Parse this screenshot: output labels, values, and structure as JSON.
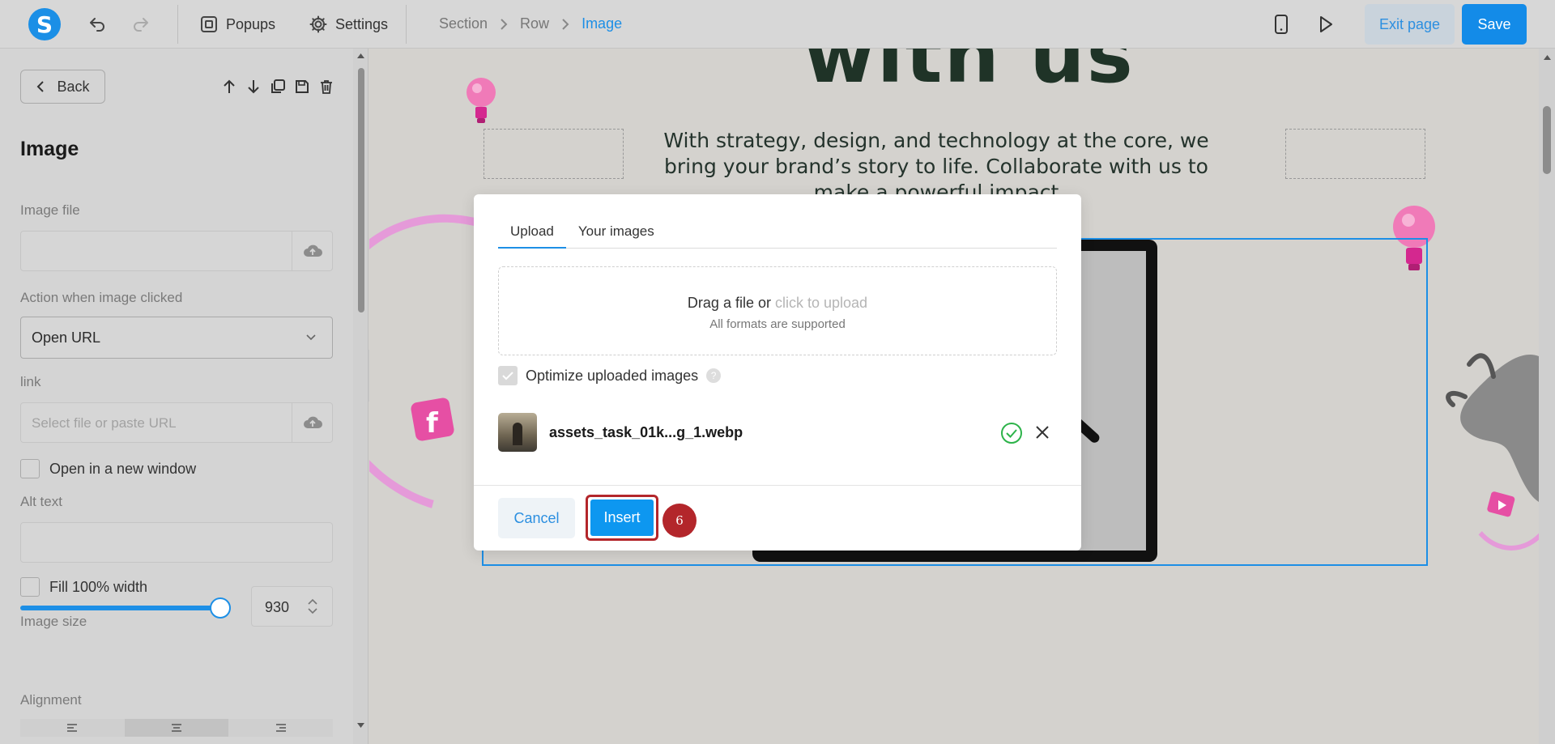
{
  "toolbar": {
    "logo_letter": "S",
    "popups_label": "Popups",
    "settings_label": "Settings",
    "breadcrumb": [
      "Section",
      "Row",
      "Image"
    ],
    "exit_label": "Exit page",
    "save_label": "Save"
  },
  "sidebar": {
    "back_label": "Back",
    "title": "Image",
    "image_file_label": "Image file",
    "action_label": "Action when image clicked",
    "action_value": "Open URL",
    "link_label": "link",
    "link_placeholder": "Select file or paste URL",
    "new_window_label": "Open in a new window",
    "alt_text_label": "Alt text",
    "fill_width_label": "Fill 100% width",
    "image_size_label": "Image size",
    "image_size_value": "930",
    "image_size_fraction": 0.95,
    "alignment_label": "Alignment"
  },
  "canvas": {
    "headline": "with us",
    "body_text": "With strategy, design, and technology at the core, we bring your brand’s story to life. Collaborate with us to make a powerful impact"
  },
  "modal": {
    "tabs": [
      "Upload",
      "Your images"
    ],
    "drop_text": "Drag a file or",
    "drop_link": "click to upload",
    "drop_sub": "All formats are supported",
    "optimize_label": "Optimize uploaded images",
    "help_glyph": "?",
    "file_name": "assets_task_01k...g_1.webp",
    "cancel_label": "Cancel",
    "insert_label": "Insert"
  },
  "step_badge": "6",
  "colors": {
    "accent": "#1d8fe6",
    "highlight": "#b3262b",
    "success": "#2db34a"
  }
}
